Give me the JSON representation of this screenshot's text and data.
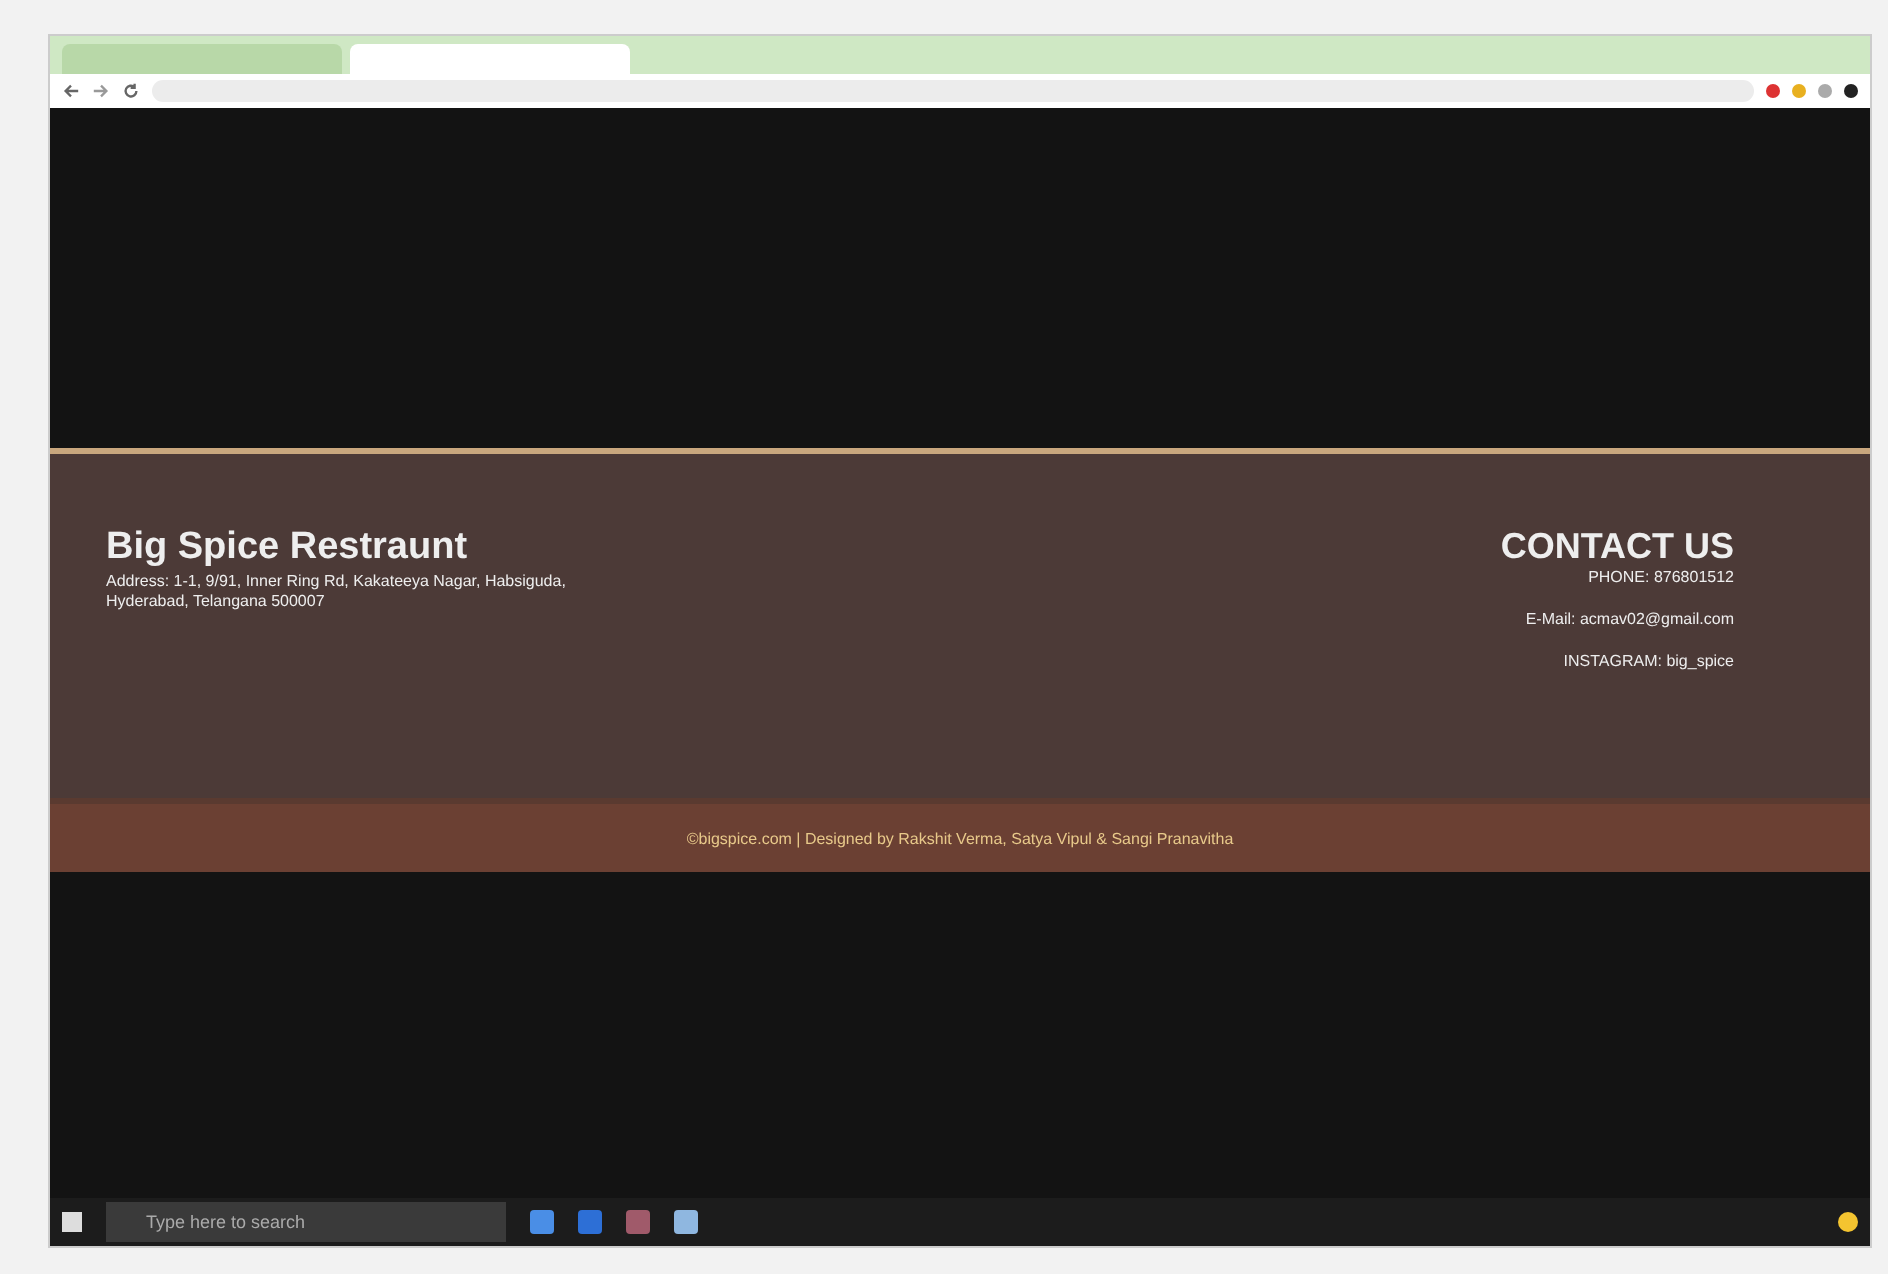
{
  "browser": {
    "tabs": [
      {
        "selected": false
      },
      {
        "selected": true
      }
    ]
  },
  "restaurant": {
    "name": "Big Spice Restraunt",
    "address": "Address: 1-1, 9/91, Inner Ring Rd, Kakateeya Nagar, Habsiguda, Hyderabad, Telangana 500007"
  },
  "contact": {
    "heading": "CONTACT US",
    "lines": [
      "PHONE: 876801512",
      "E-Mail: acmav02@gmail.com",
      "INSTAGRAM: big_spice"
    ]
  },
  "footer": {
    "credit": "©bigspice.com | Designed by Rakshit Verma, Satya Vipul & Sangi Pranavitha"
  },
  "taskbar": {
    "search_placeholder": "Type here to search"
  }
}
